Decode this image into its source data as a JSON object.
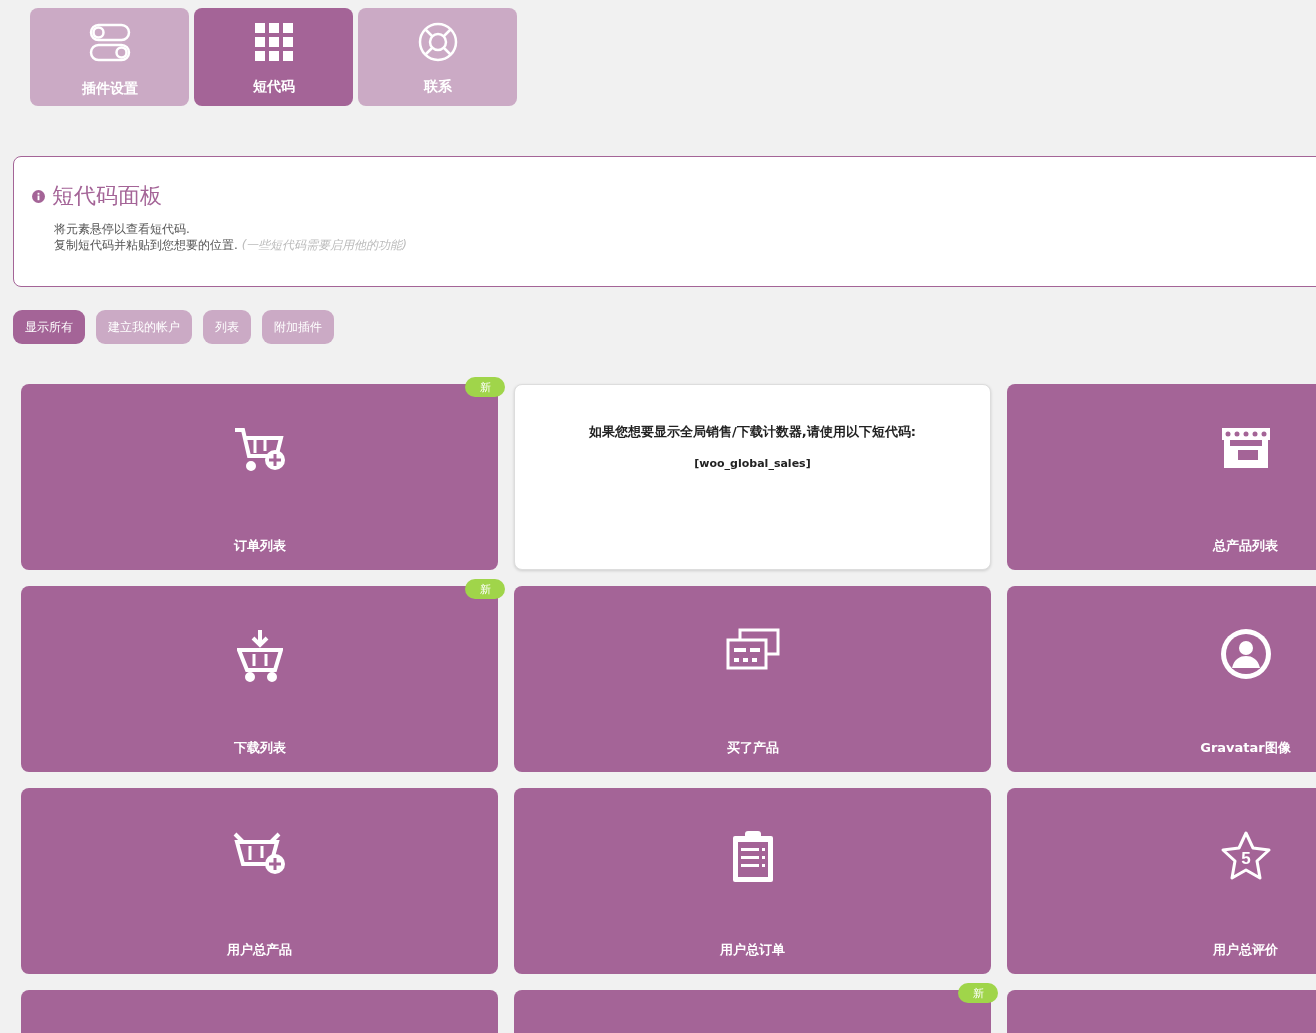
{
  "tabs": [
    {
      "label": "插件设置",
      "selected": false
    },
    {
      "label": "短代码",
      "selected": true
    },
    {
      "label": "联系",
      "selected": false
    }
  ],
  "info_panel": {
    "title": "短代码面板",
    "lines": [
      "将元素悬停以查看短代码.",
      "复制短代码并粘贴到您想要的位置."
    ],
    "note": "(一些短代码需要启用他的功能)"
  },
  "filters": [
    {
      "label": "显示所有",
      "selected": true
    },
    {
      "label": "建立我的帐户",
      "selected": false
    },
    {
      "label": "列表",
      "selected": false
    },
    {
      "label": "附加插件",
      "selected": false
    }
  ],
  "cards": [
    {
      "kind": "feature",
      "label": "订单列表",
      "badge": "新"
    },
    {
      "kind": "notice",
      "text": "如果您想要显示全局销售/下载计数器,请使用以下短代码:",
      "code": "[woo_global_sales]"
    },
    {
      "kind": "feature",
      "label": "总产品列表"
    },
    {
      "kind": "feature",
      "label": "下载列表",
      "badge": "新"
    },
    {
      "kind": "feature",
      "label": "买了产品"
    },
    {
      "kind": "feature",
      "label": "Gravatar图像"
    },
    {
      "kind": "feature",
      "label": "用户总产品"
    },
    {
      "kind": "feature",
      "label": "用户总订单"
    },
    {
      "kind": "feature",
      "label": "用户总评价",
      "icon_text": "5"
    },
    {
      "kind": "feature"
    },
    {
      "kind": "feature",
      "badge": "新"
    },
    {
      "kind": "feature"
    }
  ]
}
